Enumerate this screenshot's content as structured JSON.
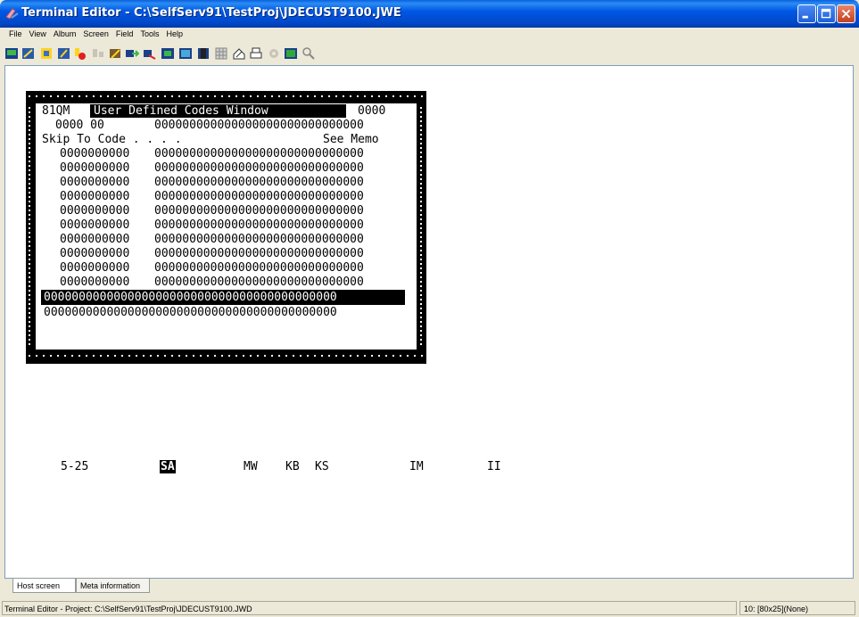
{
  "window": {
    "title": "Terminal Editor - C:\\SelfServ91\\TestProj\\JDECUST9100.JWE",
    "title_bar_color": "#0054e3",
    "buttons": [
      "minimize-icon",
      "maximize-icon",
      "close-icon"
    ]
  },
  "menu": [
    "File",
    "View",
    "Album",
    "Screen",
    "Field",
    "Tools",
    "Help"
  ],
  "toolbar": {
    "icons": [
      "new-screen-icon",
      "edit-field-icon",
      "yellow-marker-icon",
      "blue-marker-icon",
      "record-icon",
      "disabled-field-icon",
      "wizard-icon",
      "navigate-icon",
      "navigate-back-icon",
      "screen-capture-icon",
      "view-screen-icon",
      "film-icon",
      "grid-icon",
      "house-edit-icon",
      "print-icon",
      "gear-disabled-icon",
      "green-screen-icon",
      "search-icon"
    ]
  },
  "terminal": {
    "line1_code": "81QM",
    "line1_title": "User Defined Codes Window",
    "line1_num": "0000",
    "line2_left": "0000 00",
    "line2_right": "000000000000000000000000000000",
    "line3_left": "Skip To Code . . . .",
    "line3_right": "See Memo",
    "rows": [
      {
        "code": "0000000000",
        "desc": "000000000000000000000000000000"
      },
      {
        "code": "0000000000",
        "desc": "000000000000000000000000000000"
      },
      {
        "code": "0000000000",
        "desc": "000000000000000000000000000000"
      },
      {
        "code": "0000000000",
        "desc": "000000000000000000000000000000"
      },
      {
        "code": "0000000000",
        "desc": "000000000000000000000000000000"
      },
      {
        "code": "0000000000",
        "desc": "000000000000000000000000000000"
      },
      {
        "code": "0000000000",
        "desc": "000000000000000000000000000000"
      },
      {
        "code": "0000000000",
        "desc": "000000000000000000000000000000"
      },
      {
        "code": "0000000000",
        "desc": "000000000000000000000000000000"
      },
      {
        "code": "0000000000",
        "desc": "000000000000000000000000000000"
      }
    ],
    "full_line_1": "000000000000000000000000000000000000000000",
    "full_line_2": "000000000000000000000000000000000000000000",
    "bottom_labels": [
      "5-25",
      "SA",
      "MW",
      "KB",
      "KS",
      "IM",
      "II"
    ]
  },
  "tabs": [
    "Host screen",
    "Meta information"
  ],
  "status": {
    "left": "Terminal Editor - Project: C:\\SelfServ91\\TestProj\\JDECUST9100.JWD",
    "right": "10: [80x25](None)"
  }
}
